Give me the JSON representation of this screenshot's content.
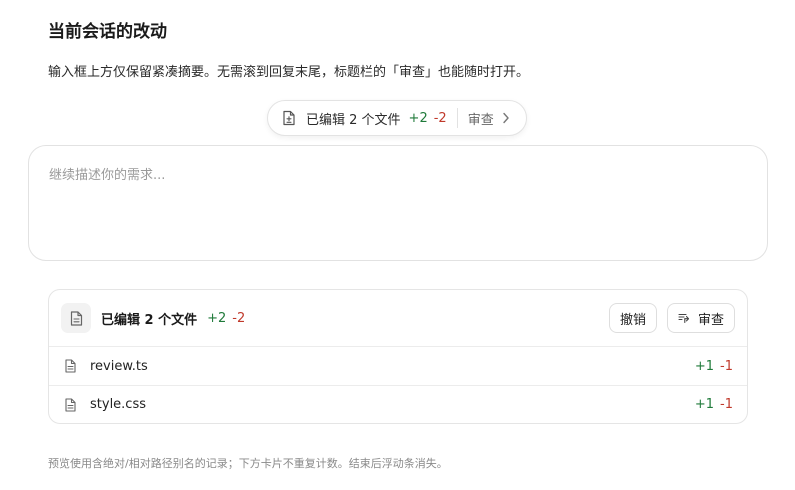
{
  "header": {
    "title": "当前会话的改动",
    "subtitle": "输入框上方仅保留紧凑摘要。无需滚到回复末尾，标题栏的「审查」也能随时打开。"
  },
  "pill": {
    "icon": "file-diff-icon",
    "label": "已编辑 2 个文件",
    "added": "+2",
    "removed": "-2",
    "review_label": "审查"
  },
  "composer": {
    "placeholder": "继续描述你的需求...",
    "value": ""
  },
  "changes_card": {
    "icon": "document-icon",
    "label": "已编辑 2 个文件",
    "added": "+2",
    "removed": "-2",
    "undo_label": "撤销",
    "review_label": "审查",
    "files": [
      {
        "name": "review.ts",
        "added": "+1",
        "removed": "-1"
      },
      {
        "name": "style.css",
        "added": "+1",
        "removed": "-1"
      }
    ]
  },
  "footnote": "预览使用含绝对/相对路径别名的记录；下方卡片不重复计数。结束后浮动条消失。",
  "colors": {
    "added": "#1f7a3a",
    "removed": "#c0392b",
    "border": "#e2e2e2"
  }
}
